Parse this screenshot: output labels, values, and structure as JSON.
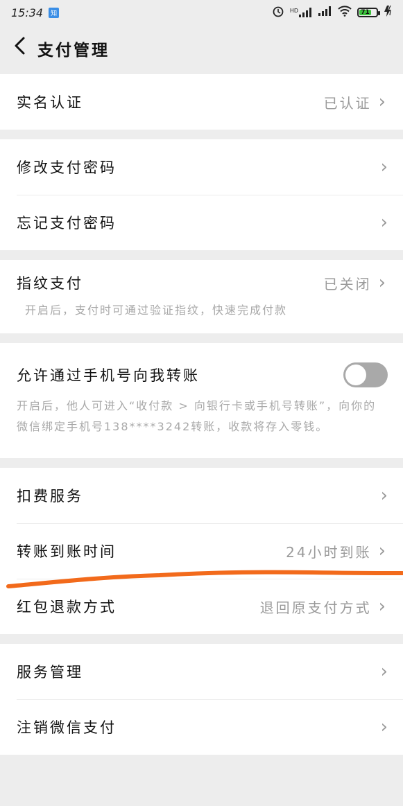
{
  "status": {
    "time": "15:34",
    "app_badge": "知",
    "alarm_icon": "alarm-icon",
    "hd": "HD",
    "battery": "71",
    "charging_icon": "charging-icon"
  },
  "header": {
    "title": "支付管理",
    "back_icon": "chevron-left-icon"
  },
  "rows": {
    "real_name": {
      "label": "实名认证",
      "value": "已认证"
    },
    "change_pwd": {
      "label": "修改支付密码"
    },
    "forgot_pwd": {
      "label": "忘记支付密码"
    },
    "fingerprint": {
      "label": "指纹支付",
      "value": "已关闭",
      "desc": "开启后，支付时可通过验证指纹，快速完成付款"
    },
    "phone_transfer": {
      "label": "允许通过手机号向我转账",
      "desc": "开启后，他人可进入“收付款 > 向银行卡或手机号转账”，向你的微信绑定手机号138****3242转账，收款将存入零钱。",
      "enabled": false
    },
    "deduction": {
      "label": "扣费服务"
    },
    "transfer_time": {
      "label": "转账到账时间",
      "value": "24小时到账"
    },
    "red_packet_refund": {
      "label": "红包退款方式",
      "value": "退回原支付方式"
    },
    "service_mgmt": {
      "label": "服务管理"
    },
    "deregister": {
      "label": "注销微信支付"
    }
  },
  "chevron": "›",
  "colors": {
    "annotation": "#f26a1b",
    "toggle_off": "#a9a9a9"
  }
}
